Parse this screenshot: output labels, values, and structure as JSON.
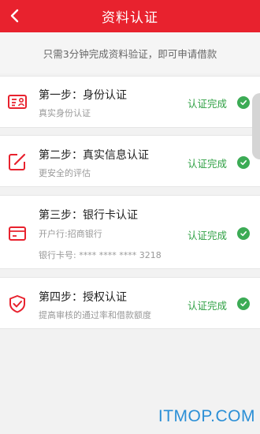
{
  "header": {
    "title": "资料认证",
    "back_icon": "chevron-left-icon"
  },
  "notice": "只需3分钟完成资料验证，即可申请借款",
  "colors": {
    "brand": "#e8222e",
    "success": "#3cab55"
  },
  "steps": [
    {
      "title": "第一步：身份认证",
      "subtitle": "真实身份认证",
      "status": "认证完成",
      "icon": "id-card-icon"
    },
    {
      "title": "第二步：真实信息认证",
      "subtitle": "更安全的评估",
      "status": "认证完成",
      "icon": "edit-icon"
    },
    {
      "title": "第三步：银行卡认证",
      "subtitle": "开户行:招商银行",
      "detail": "银行卡号: **** **** **** 3218",
      "status": "认证完成",
      "icon": "bank-card-icon"
    },
    {
      "title": "第四步：授权认证",
      "subtitle": "提高审核的通过率和借款额度",
      "status": "认证完成",
      "icon": "shield-check-icon"
    }
  ],
  "watermark": "ITMOP.COM"
}
